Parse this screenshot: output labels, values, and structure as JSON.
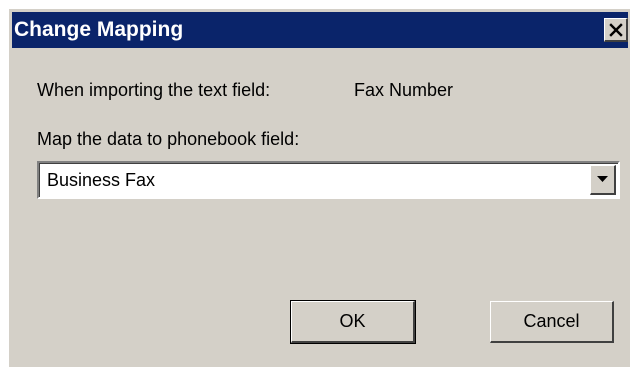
{
  "dialog": {
    "title": "Change Mapping",
    "close_icon": "close-icon"
  },
  "import_label": "When importing the text field:",
  "import_field_value": "Fax Number",
  "map_label": "Map the data to phonebook field:",
  "mapping_select": {
    "selected_value": "Business Fax",
    "arrow_icon": "chevron-down-icon"
  },
  "buttons": {
    "ok_label": "OK",
    "cancel_label": "Cancel"
  },
  "colors": {
    "titlebar": "#0a246a",
    "dialog_face": "#d4d0c8"
  }
}
